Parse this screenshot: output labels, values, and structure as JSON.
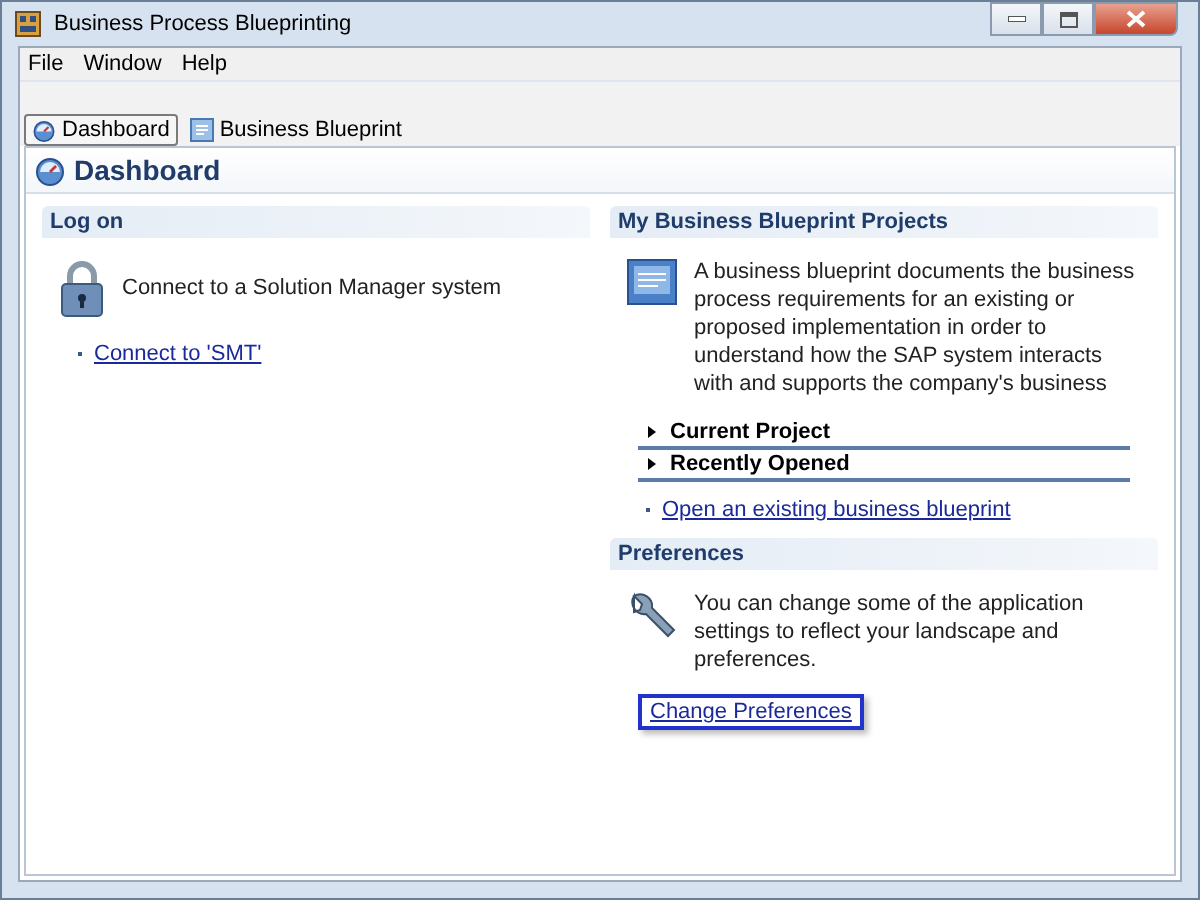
{
  "window": {
    "title": "Business Process Blueprinting"
  },
  "menu": [
    "File",
    "Window",
    "Help"
  ],
  "tabs": [
    {
      "label": "Dashboard",
      "selected": true,
      "kind": "dashboard"
    },
    {
      "label": "Business Blueprint",
      "selected": false,
      "kind": "blueprint"
    }
  ],
  "page_title": "Dashboard",
  "logon": {
    "title": "Log on",
    "text": "Connect to a Solution Manager system",
    "link": "Connect to 'SMT'"
  },
  "projects": {
    "title": "My Business Blueprint Projects",
    "text": "A business blueprint documents the business process requirements for an existing or proposed implementation in order to understand how the SAP system interacts with and supports the company's business",
    "sections": [
      {
        "label": "Current Project",
        "expanded": false
      },
      {
        "label": "Recently Opened",
        "expanded": false
      }
    ],
    "link": "Open an existing business blueprint"
  },
  "preferences": {
    "title": "Preferences",
    "text": "You can change some of the application settings to reflect your landscape and preferences.",
    "link": "Change Preferences",
    "focused": true
  }
}
